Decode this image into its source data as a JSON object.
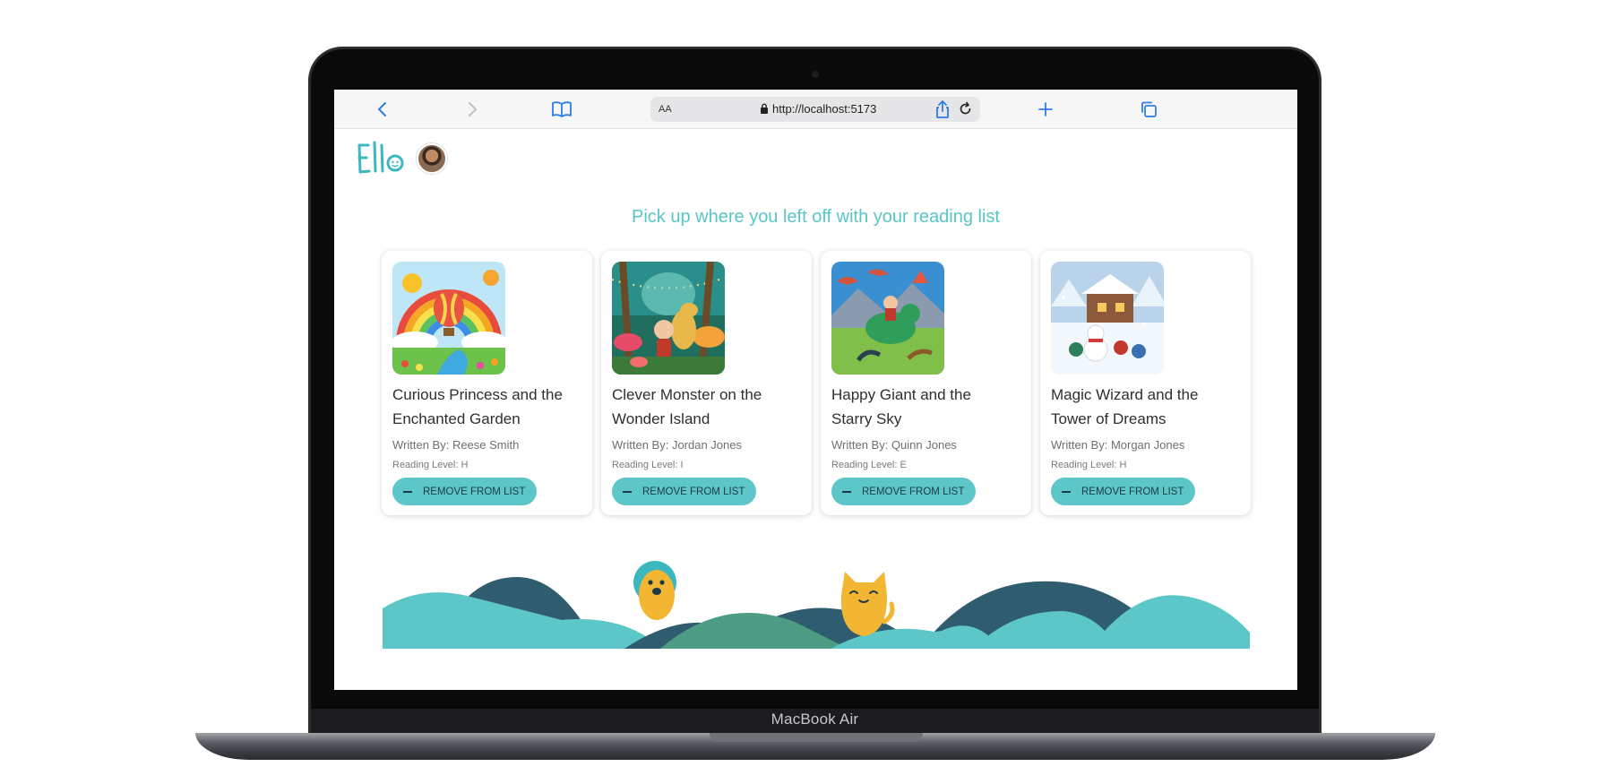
{
  "device": {
    "label": "MacBook Air"
  },
  "browser": {
    "text_size_label": "AA",
    "url": "http://localhost:5173",
    "icons": [
      "back-icon",
      "forward-icon",
      "bookmarks-icon",
      "lock-icon",
      "reload-icon",
      "share-icon",
      "new-tab-icon",
      "tabs-icon"
    ]
  },
  "app": {
    "logo_text": "Ello",
    "headline": "Pick up where you left off with your reading list",
    "accent_color": "#5cc6c8",
    "books": [
      {
        "title": "Curious Princess and the Enchanted Garden",
        "author": "Written By: Reese Smith",
        "level": "Reading Level: H",
        "button": "REMOVE FROM LIST"
      },
      {
        "title": "Clever Monster on the Wonder Island",
        "author": "Written By: Jordan Jones",
        "level": "Reading Level: I",
        "button": "REMOVE FROM LIST"
      },
      {
        "title": "Happy Giant and the Starry Sky",
        "author": "Written By: Quinn Jones",
        "level": "Reading Level: E",
        "button": "REMOVE FROM LIST"
      },
      {
        "title": "Magic Wizard and the Tower of Dreams",
        "author": "Written By: Morgan Jones",
        "level": "Reading Level: H",
        "button": "REMOVE FROM LIST"
      }
    ]
  }
}
